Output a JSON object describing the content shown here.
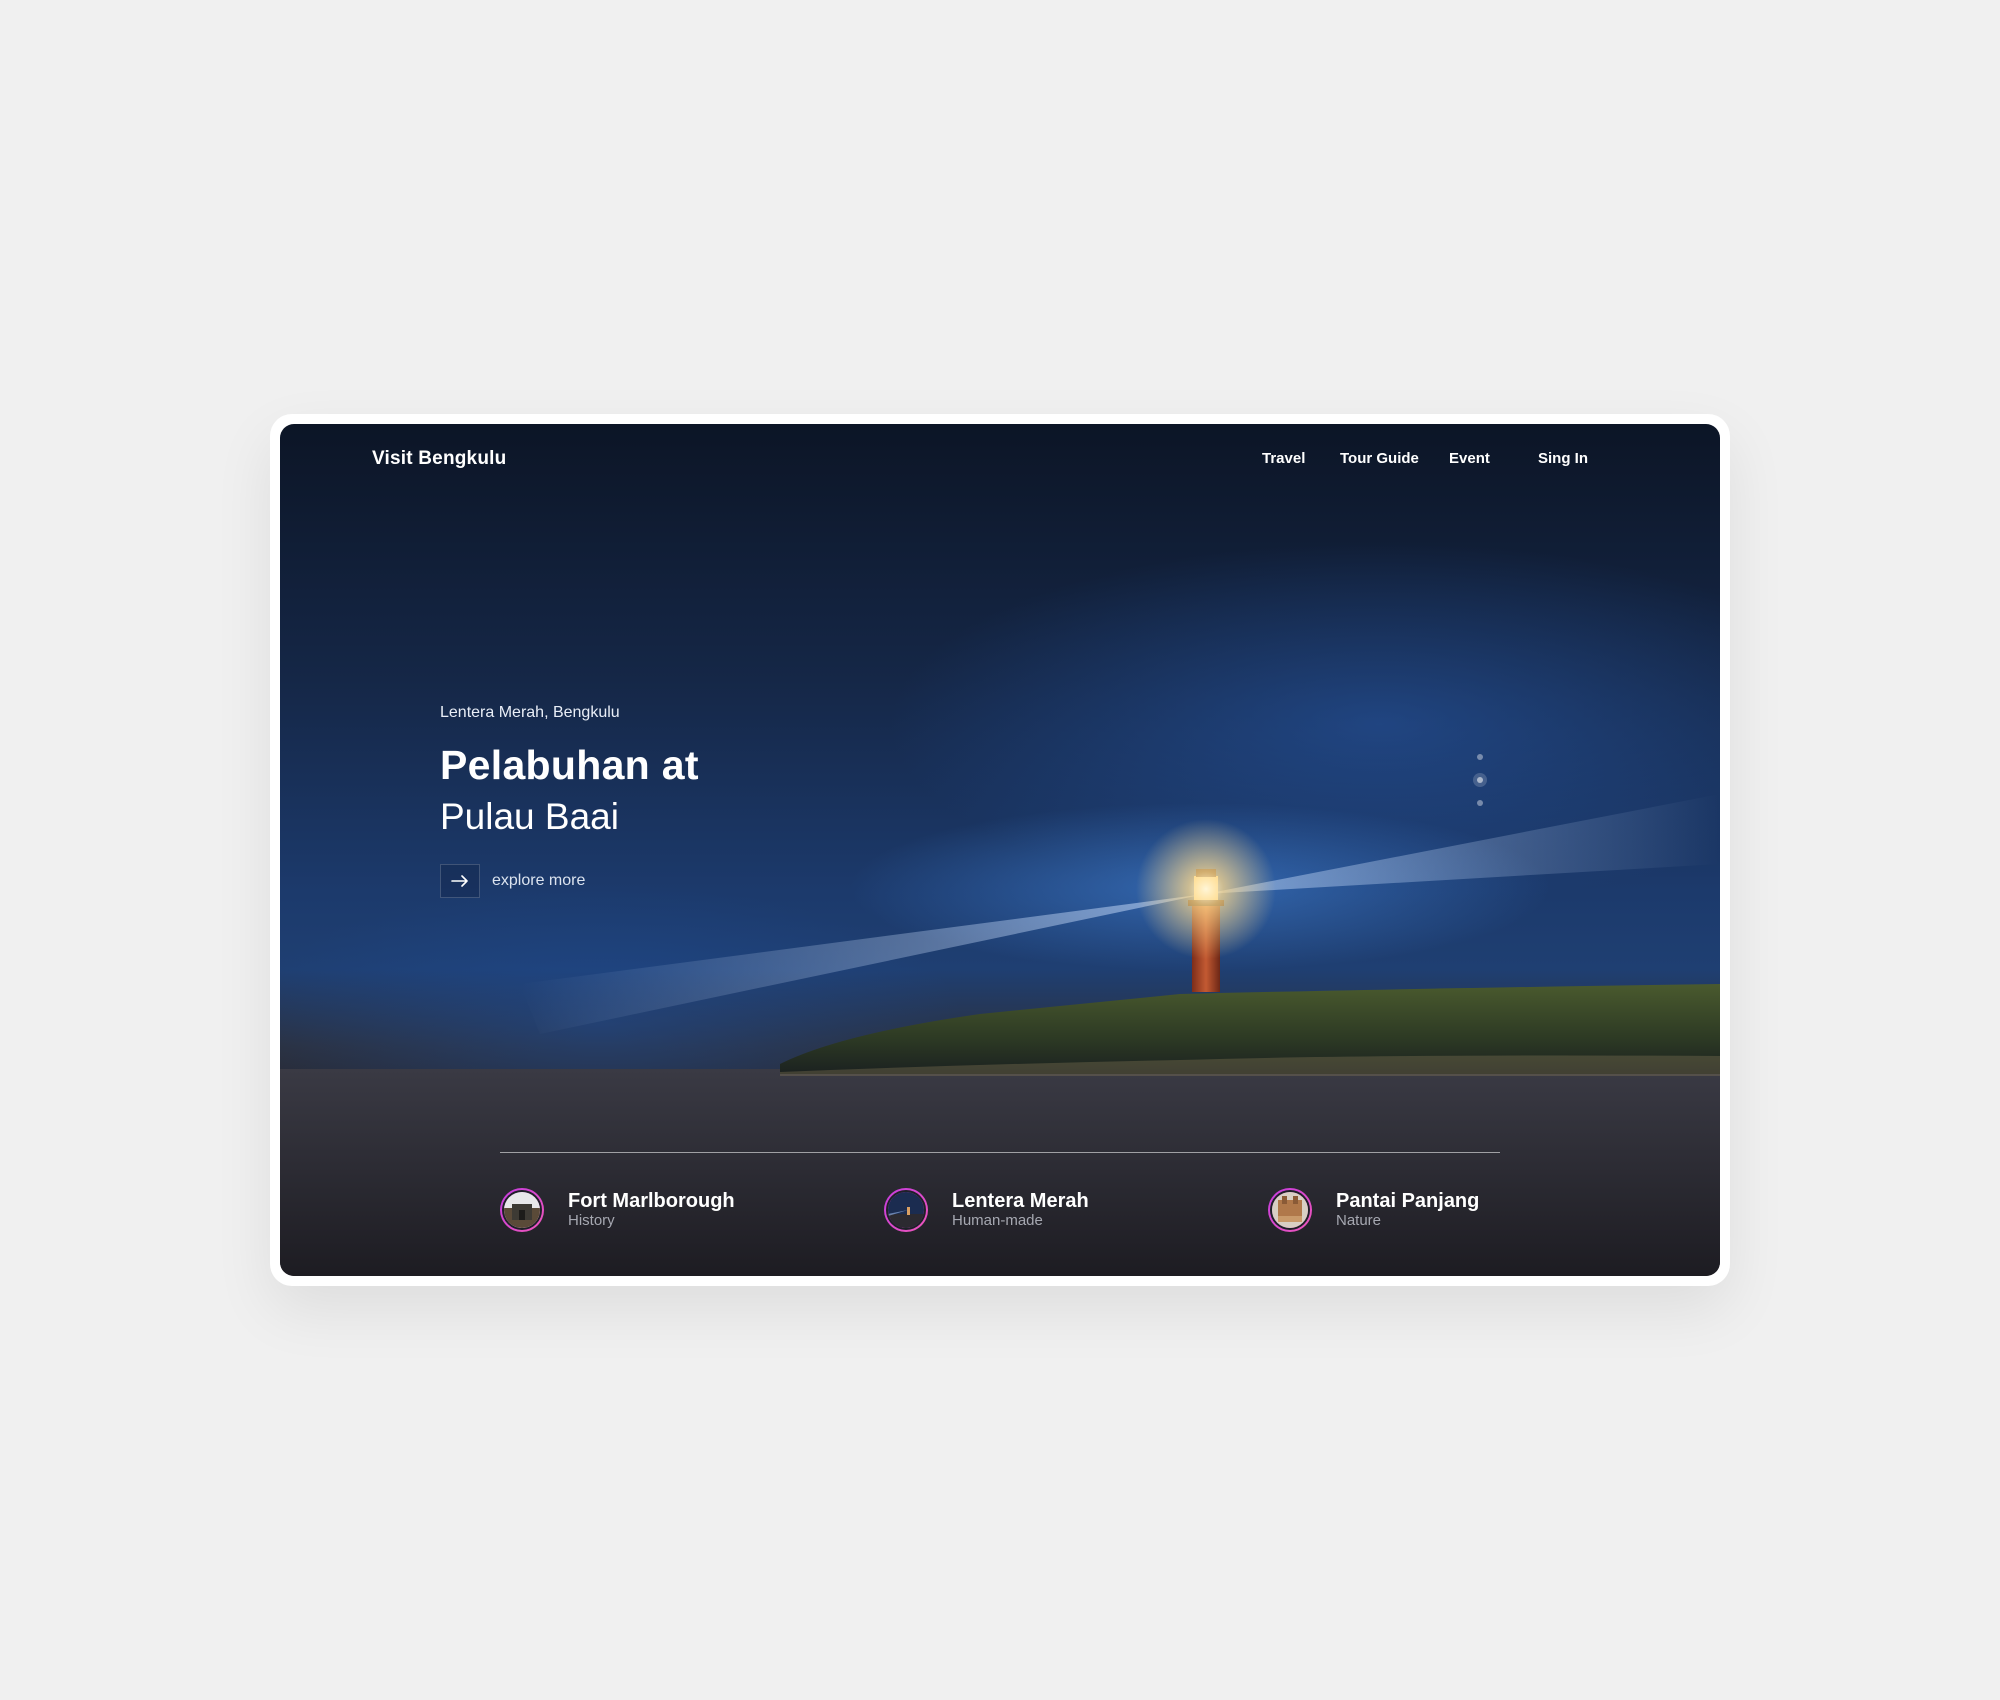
{
  "brand": "Visit Bengkulu",
  "nav": {
    "items": [
      {
        "label": "Travel"
      },
      {
        "label": "Tour Guide"
      },
      {
        "label": "Event"
      },
      {
        "label": "Sing In"
      }
    ]
  },
  "hero": {
    "location": "Lentera Merah, Bengkulu",
    "title_bold": "Pelabuhan at",
    "title_light": "Pulau Baai",
    "cta_label": "explore more",
    "cta_icon": "arrow-right-icon",
    "slides": {
      "count": 3,
      "active_index": 1
    }
  },
  "destinations": [
    {
      "name": "Fort Marlborough",
      "category": "History",
      "thumb": "fort-thumbnail"
    },
    {
      "name": "Lentera Merah",
      "category": "Human-made",
      "thumb": "lighthouse-thumbnail"
    },
    {
      "name": "Pantai Panjang",
      "category": "Nature",
      "thumb": "beach-thumbnail"
    }
  ],
  "colors": {
    "page_bg": "#f0f0f0",
    "frame": "#ffffff",
    "sky_dark": "#0c1526",
    "sky_blue": "#1f3f72",
    "lighthouse": "#b5472a",
    "thumb_ring": "#c43be0",
    "muted_text": "#a6a8b1"
  }
}
